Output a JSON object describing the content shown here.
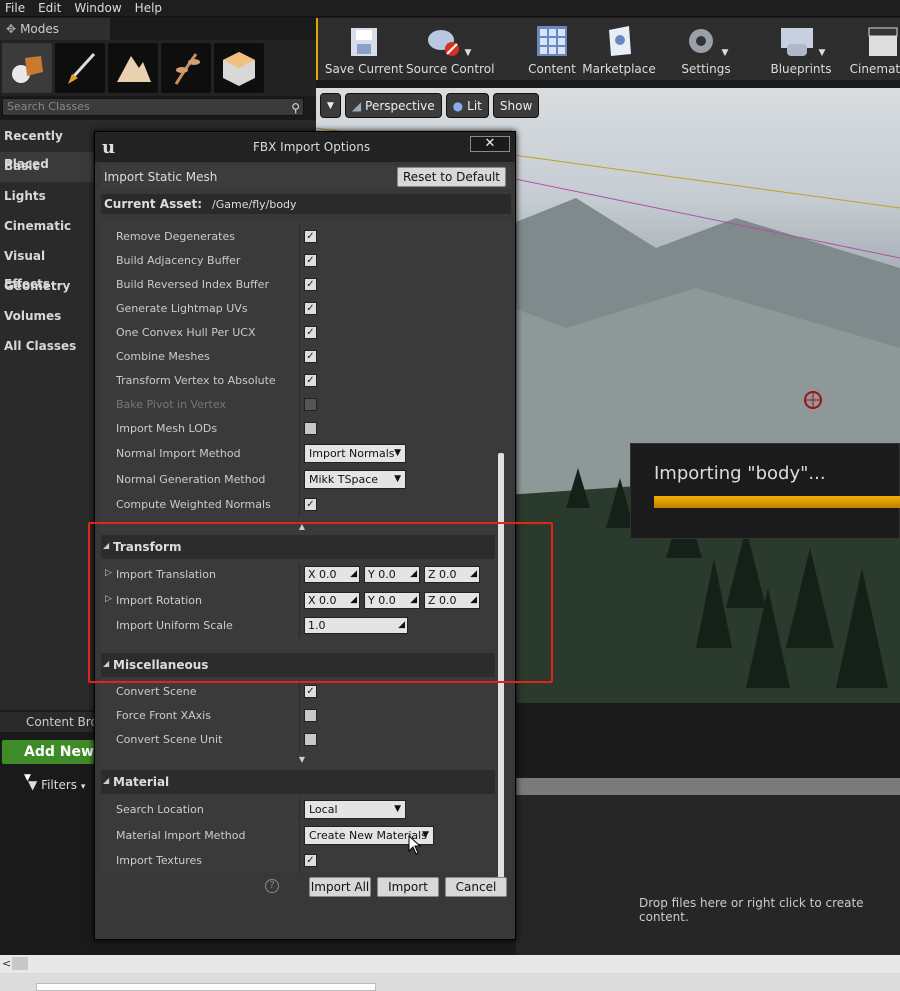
{
  "menubar": {
    "items": [
      "File",
      "Edit",
      "Window",
      "Help"
    ]
  },
  "modes": {
    "tab_label": "Modes",
    "search_placeholder": "Search Classes"
  },
  "categories": [
    "Recently Placed",
    "Basic",
    "Lights",
    "Cinematic",
    "Visual Effects",
    "Geometry",
    "Volumes",
    "All Classes"
  ],
  "toolbar": {
    "save": "Save Current",
    "source_control": "Source Control",
    "content": "Content",
    "marketplace": "Marketplace",
    "settings": "Settings",
    "blueprints": "Blueprints",
    "cinematics": "Cinematics"
  },
  "viewport": {
    "perspective": "Perspective",
    "lit": "Lit",
    "show": "Show",
    "importing_text": "Importing \"body\"...",
    "progress": 1.0
  },
  "content_browser": {
    "tab": "Content Browser",
    "add_new": "Add New",
    "filters": "Filters",
    "drop_text": "Drop files here or right click to create content."
  },
  "dialog": {
    "title": "FBX Import Options",
    "import_type": "Import Static Mesh",
    "reset": "Reset to Default",
    "current_asset_label": "Current Asset:",
    "current_asset_value": "/Game/fly/body",
    "rows": [
      {
        "label": "Remove Degenerates",
        "type": "check",
        "checked": true
      },
      {
        "label": "Build Adjacency Buffer",
        "type": "check",
        "checked": true
      },
      {
        "label": "Build Reversed Index Buffer",
        "type": "check",
        "checked": true
      },
      {
        "label": "Generate Lightmap UVs",
        "type": "check",
        "checked": true
      },
      {
        "label": "One Convex Hull Per UCX",
        "type": "check",
        "checked": true
      },
      {
        "label": "Combine Meshes",
        "type": "check",
        "checked": true
      },
      {
        "label": "Transform Vertex to Absolute",
        "type": "check",
        "checked": true
      },
      {
        "label": "Bake Pivot in Vertex",
        "type": "check",
        "checked": false,
        "disabled": true
      },
      {
        "label": "Import Mesh LODs",
        "type": "check",
        "checked": false
      },
      {
        "label": "Normal Import Method",
        "type": "dropdown",
        "value": "Import Normals"
      },
      {
        "label": "Normal Generation Method",
        "type": "dropdown",
        "value": "Mikk TSpace"
      },
      {
        "label": "Compute Weighted Normals",
        "type": "check",
        "checked": true
      }
    ],
    "transform": {
      "section": "Transform",
      "translation_label": "Import Translation",
      "rotation_label": "Import Rotation",
      "scale_label": "Import Uniform Scale",
      "translation": {
        "x": "X",
        "x_val": "0.0",
        "y": "Y",
        "y_val": "0.0",
        "z": "Z",
        "z_val": "0.0"
      },
      "rotation": {
        "x": "X",
        "x_val": "0.0",
        "y": "Y",
        "y_val": "0.0",
        "z": "Z",
        "z_val": "0.0"
      },
      "scale": "1.0"
    },
    "misc": {
      "section": "Miscellaneous",
      "rows": [
        {
          "label": "Convert Scene",
          "checked": true
        },
        {
          "label": "Force Front XAxis",
          "checked": false
        },
        {
          "label": "Convert Scene Unit",
          "checked": false
        }
      ]
    },
    "material": {
      "section": "Material",
      "search_location_label": "Search Location",
      "search_location": "Local",
      "import_method_label": "Material Import Method",
      "import_method": "Create New Materials",
      "textures_label": "Import Textures"
    },
    "buttons": {
      "help": "?",
      "import_all": "Import All",
      "import": "Import",
      "cancel": "Cancel"
    }
  }
}
